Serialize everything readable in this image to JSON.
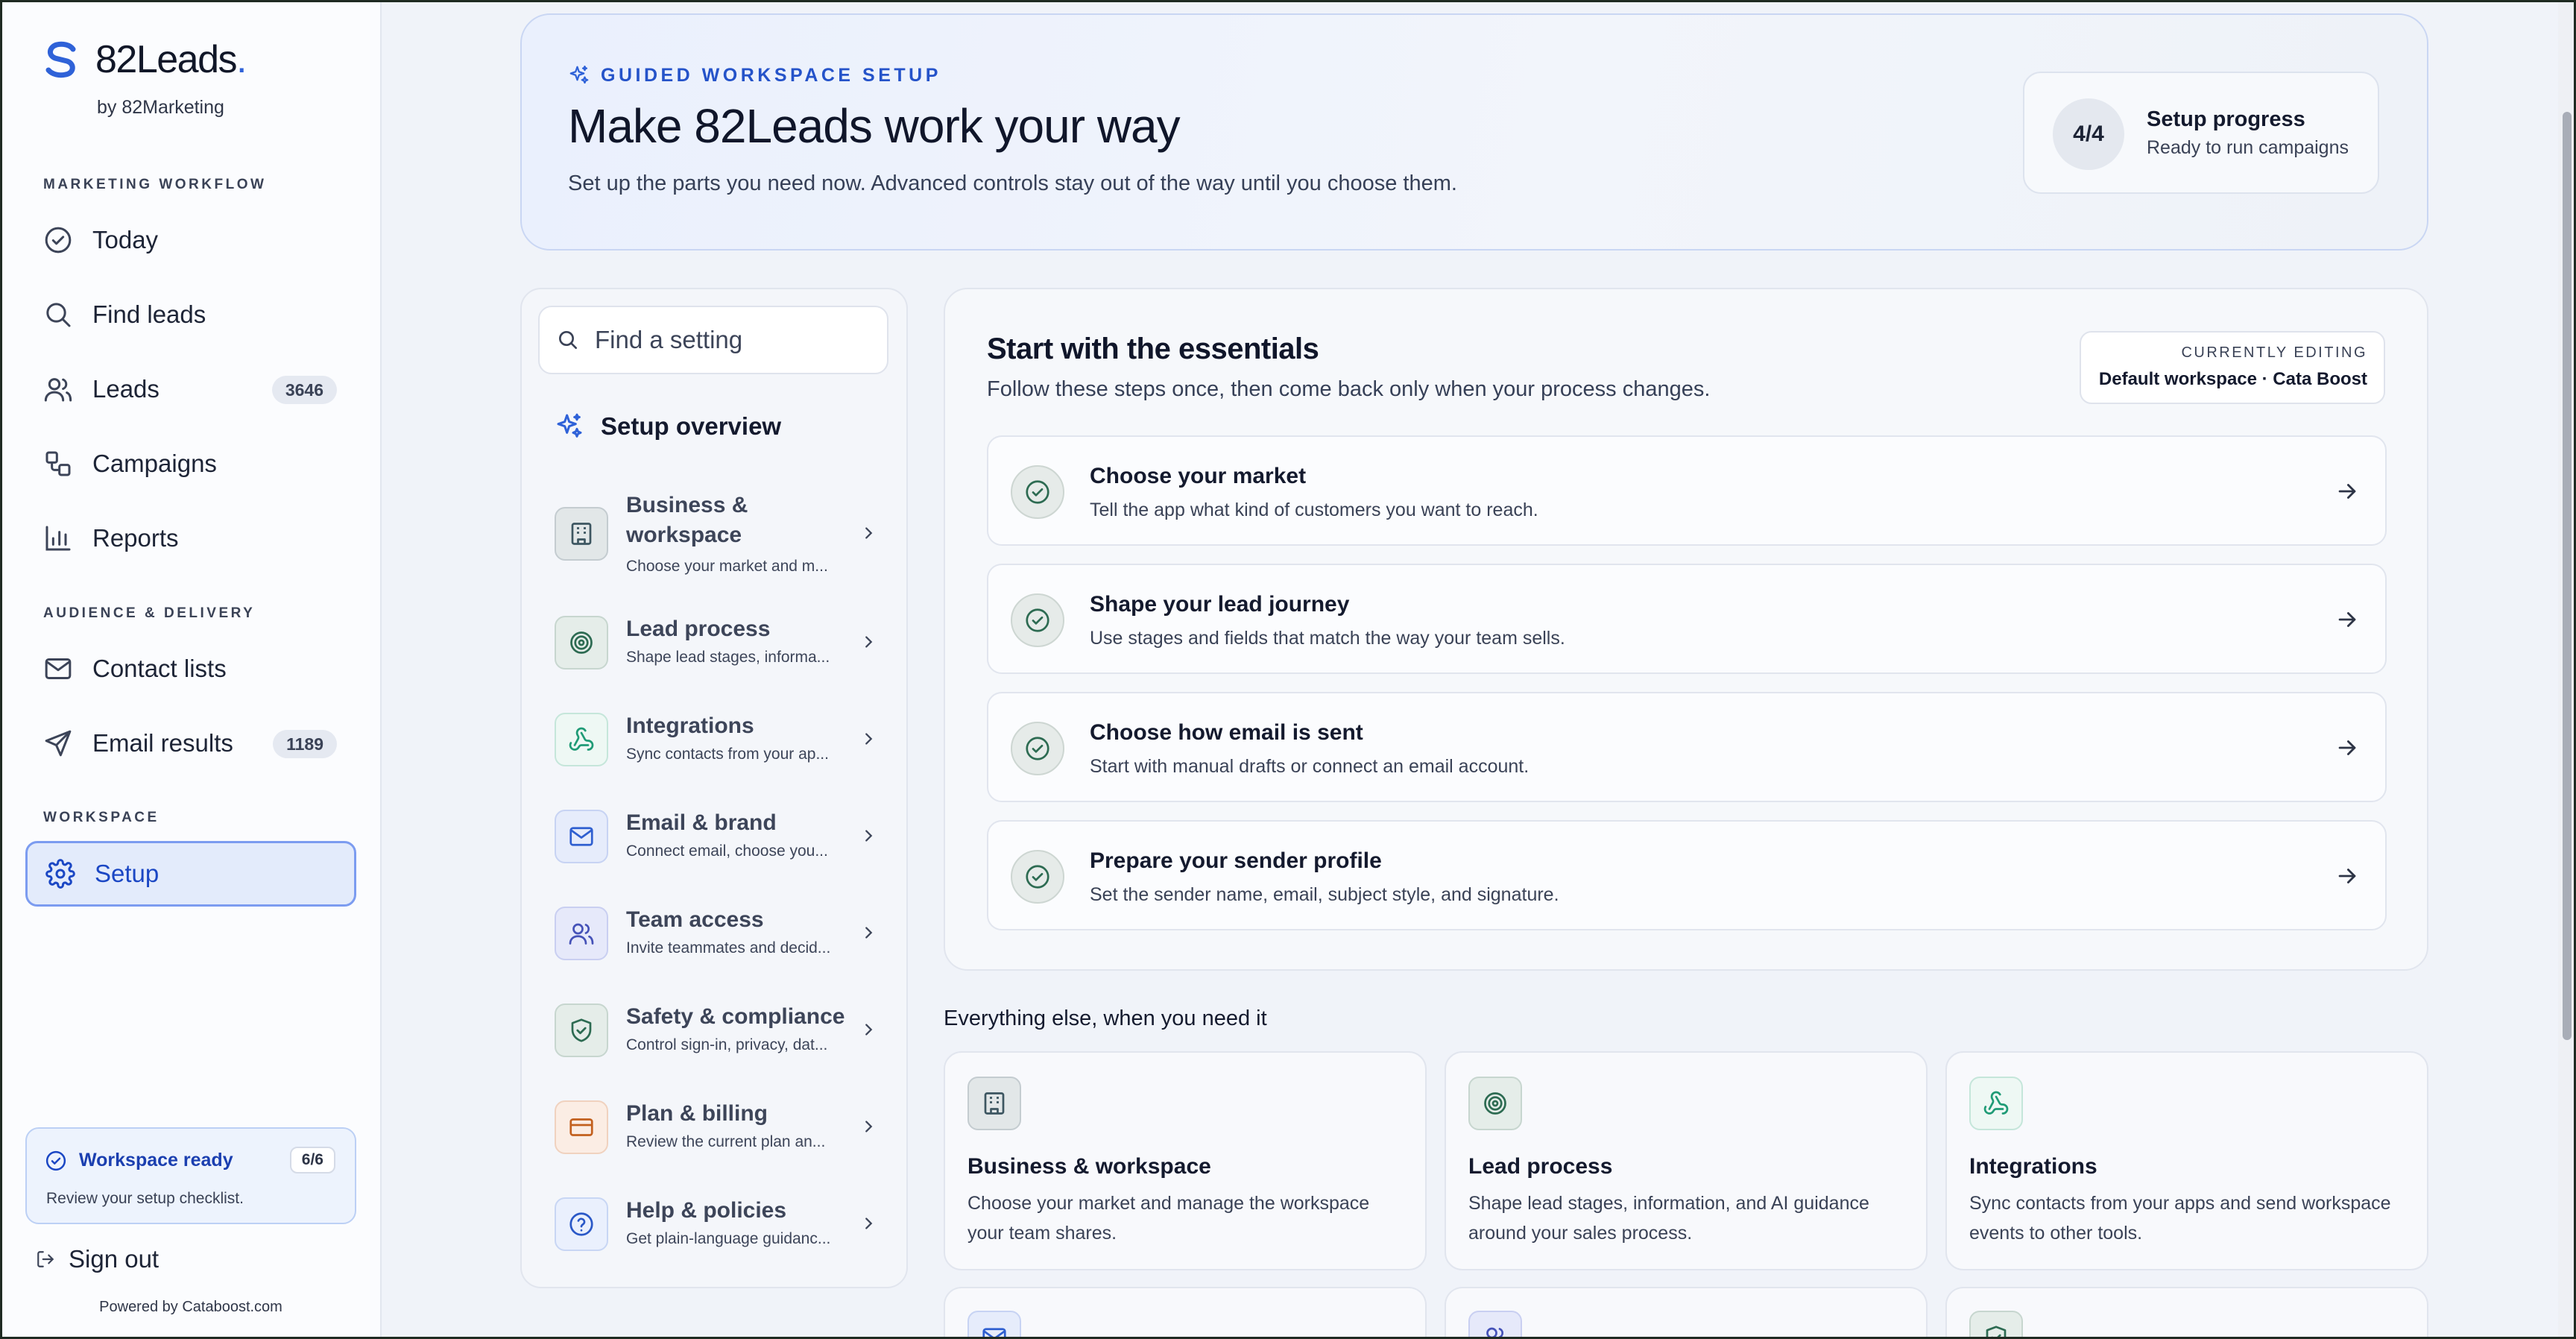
{
  "brand": {
    "name": "82Leads",
    "dot": ".",
    "sub": "by 82Marketing",
    "accent": "#2f62d8"
  },
  "sidebar": {
    "sections": {
      "marketing": "MARKETING WORKFLOW",
      "audience": "AUDIENCE & DELIVERY",
      "workspace": "WORKSPACE"
    },
    "items": [
      {
        "label": "Today",
        "icon": "check-circle-icon"
      },
      {
        "label": "Find leads",
        "icon": "search-icon"
      },
      {
        "label": "Leads",
        "icon": "users-icon",
        "count": "3646"
      },
      {
        "label": "Campaigns",
        "icon": "workflow-icon"
      },
      {
        "label": "Reports",
        "icon": "bar-chart-icon"
      },
      {
        "label": "Contact lists",
        "icon": "mail-icon"
      },
      {
        "label": "Email results",
        "icon": "send-icon",
        "count": "1189"
      },
      {
        "label": "Setup",
        "icon": "gear-icon",
        "active": true
      }
    ],
    "ready": {
      "title": "Workspace ready",
      "badge": "6/6",
      "sub": "Review your setup checklist."
    },
    "signout": "Sign out",
    "powered": "Powered by Cataboost.com"
  },
  "hero": {
    "eyebrow": "GUIDED WORKSPACE SETUP",
    "title": "Make 82Leads work your way",
    "subtitle": "Set up the parts you need now. Advanced controls stay out of the way until you choose them.",
    "progress": {
      "value": "4/4",
      "title": "Setup progress",
      "sub": "Ready to run campaigns"
    }
  },
  "setup_panel": {
    "search_placeholder": "Find a setting",
    "overview_title": "Setup overview",
    "items": [
      {
        "title": "Business & workspace",
        "desc": "Choose your market and m...",
        "icon": "building-icon"
      },
      {
        "title": "Lead process",
        "desc": "Shape lead stages, informa...",
        "icon": "target-icon"
      },
      {
        "title": "Integrations",
        "desc": "Sync contacts from your ap...",
        "icon": "webhook-icon"
      },
      {
        "title": "Email & brand",
        "desc": "Connect email, choose you...",
        "icon": "mail-icon"
      },
      {
        "title": "Team access",
        "desc": "Invite teammates and decid...",
        "icon": "users-icon"
      },
      {
        "title": "Safety & compliance",
        "desc": "Control sign-in, privacy, dat...",
        "icon": "shield-check-icon"
      },
      {
        "title": "Plan & billing",
        "desc": "Review the current plan an...",
        "icon": "credit-card-icon"
      },
      {
        "title": "Help & policies",
        "desc": "Get plain-language guidanc...",
        "icon": "help-circle-icon"
      }
    ]
  },
  "essentials": {
    "title": "Start with the essentials",
    "subtitle": "Follow these steps once, then come back only when your process changes.",
    "editing_label": "CURRENTLY EDITING",
    "editing_value": "Default workspace · Cata Boost",
    "steps": [
      {
        "title": "Choose your market",
        "desc": "Tell the app what kind of customers you want to reach."
      },
      {
        "title": "Shape your lead journey",
        "desc": "Use stages and fields that match the way your team sells."
      },
      {
        "title": "Choose how email is sent",
        "desc": "Start with manual drafts or connect an email account."
      },
      {
        "title": "Prepare your sender profile",
        "desc": "Set the sender name, email, subject style, and signature."
      }
    ]
  },
  "everything_else": {
    "title": "Everything else, when you need it",
    "cards": [
      {
        "title": "Business & workspace",
        "desc": "Choose your market and manage the workspace your team shares.",
        "icon": "building-icon"
      },
      {
        "title": "Lead process",
        "desc": "Shape lead stages, information, and AI guidance around your sales process.",
        "icon": "target-icon"
      },
      {
        "title": "Integrations",
        "desc": "Sync contacts from your apps and send workspace events to other tools.",
        "icon": "webhook-icon"
      },
      {
        "title": "",
        "desc": "",
        "icon": "mail-icon"
      },
      {
        "title": "",
        "desc": "",
        "icon": "users-icon"
      },
      {
        "title": "",
        "desc": "",
        "icon": "shield-check-icon"
      }
    ]
  }
}
